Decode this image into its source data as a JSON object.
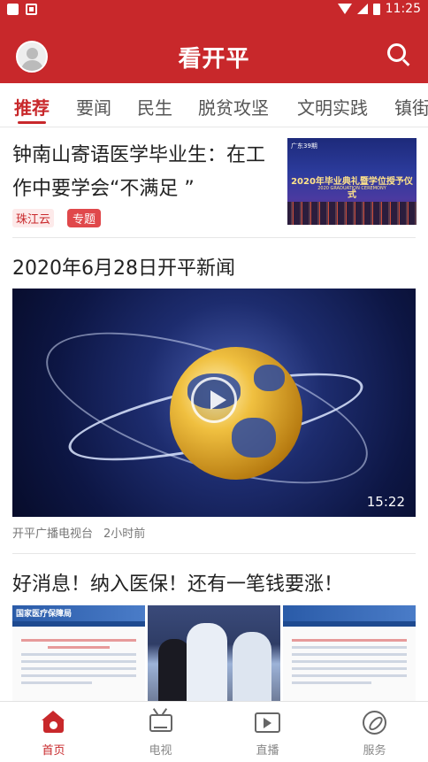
{
  "status_bar": {
    "time": "11:25"
  },
  "header": {
    "title": "看开平"
  },
  "tabs": [
    {
      "label": "推荐",
      "active": true
    },
    {
      "label": "要闻"
    },
    {
      "label": "民生"
    },
    {
      "label": "脱贫攻坚"
    },
    {
      "label": "文明实践"
    },
    {
      "label": "镇街"
    }
  ],
  "articles": [
    {
      "headline": "钟南山寄语医学毕业生：在工作中要学会“不满足 ”",
      "source_tag": "珠江云",
      "topic_tag": "专题",
      "thumb_logo": "广东39期",
      "thumb_banner": "2020年毕业典礼暨学位授予仪式",
      "thumb_banner_en": "2020 GRADUATION CEREMONY"
    },
    {
      "headline": "2020年6月28日开平新闻",
      "duration": "15:22",
      "source": "开平广播电视台",
      "time": "2小时前"
    },
    {
      "headline": "好消息！纳入医保！还有一笔钱要涨！",
      "img1_header": "国家医疗保障局",
      "img3_header": ""
    }
  ],
  "bottom_nav": [
    {
      "label": "首页",
      "active": true,
      "icon": "home-icon"
    },
    {
      "label": "电视",
      "icon": "tv-icon"
    },
    {
      "label": "直播",
      "icon": "live-icon"
    },
    {
      "label": "服务",
      "icon": "compass-icon"
    }
  ],
  "colors": {
    "brand": "#c8282b",
    "inactive": "#888888"
  }
}
